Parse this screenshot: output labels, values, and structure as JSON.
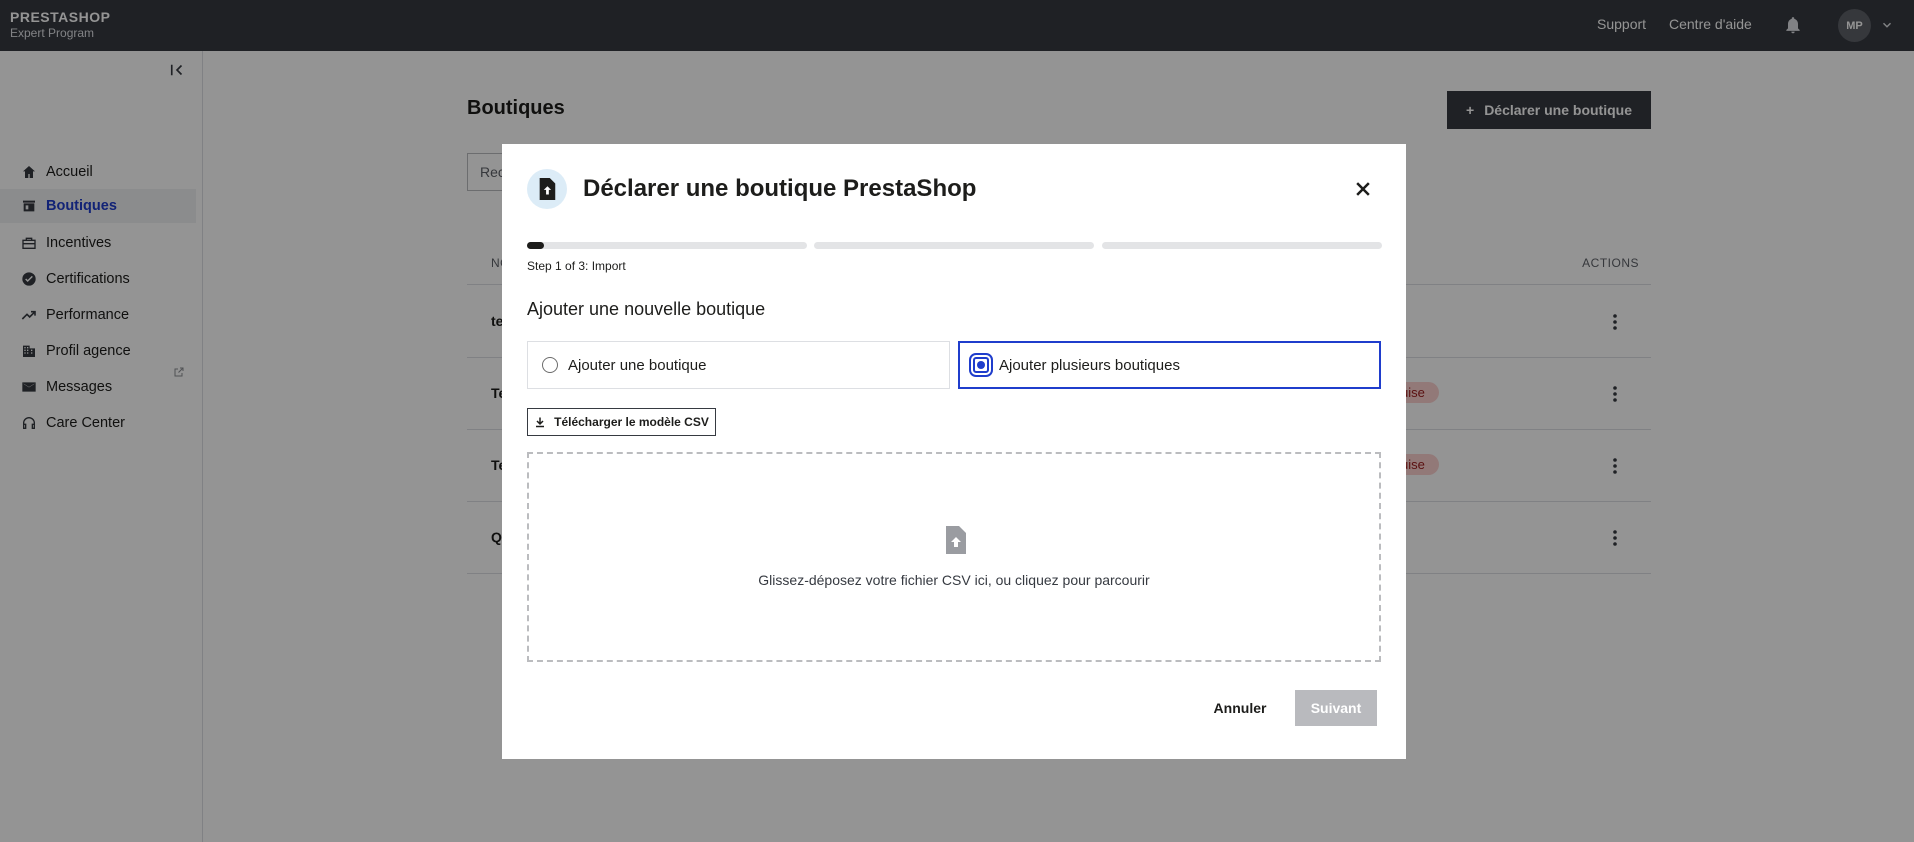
{
  "topbar": {
    "brand_name": "PRESTASHOP",
    "brand_sub": "Expert Program",
    "support": "Support",
    "help_center": "Centre d'aide",
    "avatar_initials": "MP"
  },
  "sidebar": {
    "items": [
      {
        "label": "Accueil",
        "icon": "home-icon"
      },
      {
        "label": "Boutiques",
        "icon": "store-icon",
        "active": true
      },
      {
        "label": "Incentives",
        "icon": "incentives-icon"
      },
      {
        "label": "Certifications",
        "icon": "certification-icon"
      },
      {
        "label": "Performance",
        "icon": "trending-up-icon"
      },
      {
        "label": "Profil agence",
        "icon": "building-icon"
      },
      {
        "label": "Messages",
        "icon": "mail-icon"
      },
      {
        "label": "Care Center",
        "icon": "headset-icon",
        "external": true
      }
    ]
  },
  "page": {
    "title": "Boutiques",
    "declare_button": "Déclarer une boutique",
    "search_placeholder": "Rec",
    "table": {
      "col_name": "NO",
      "col_actions": "ACTIONS",
      "rows": [
        {
          "name": "te",
          "badge": ""
        },
        {
          "name": "Te",
          "badge": "uise"
        },
        {
          "name": "Te",
          "badge": "uise"
        },
        {
          "name": "Q",
          "badge": ""
        }
      ]
    }
  },
  "modal": {
    "title": "Déclarer une boutique PrestaShop",
    "step_text": "Step 1 of 3: Import",
    "step_current": 1,
    "step_total": 3,
    "section_title": "Ajouter une nouvelle boutique",
    "option_single": "Ajouter une boutique",
    "option_multiple": "Ajouter plusieurs boutiques",
    "selected_option": "multiple",
    "csv_button": "Télécharger le modèle CSV",
    "dropzone_text": "Glissez-déposez votre fichier CSV ici, ou cliquez pour parcourir",
    "cancel": "Annuler",
    "next": "Suivant"
  },
  "colors": {
    "accent": "#1f3dcc",
    "topbar": "#363a41",
    "disabled": "#b9babe",
    "badge_bg": "#fbd0cf"
  }
}
